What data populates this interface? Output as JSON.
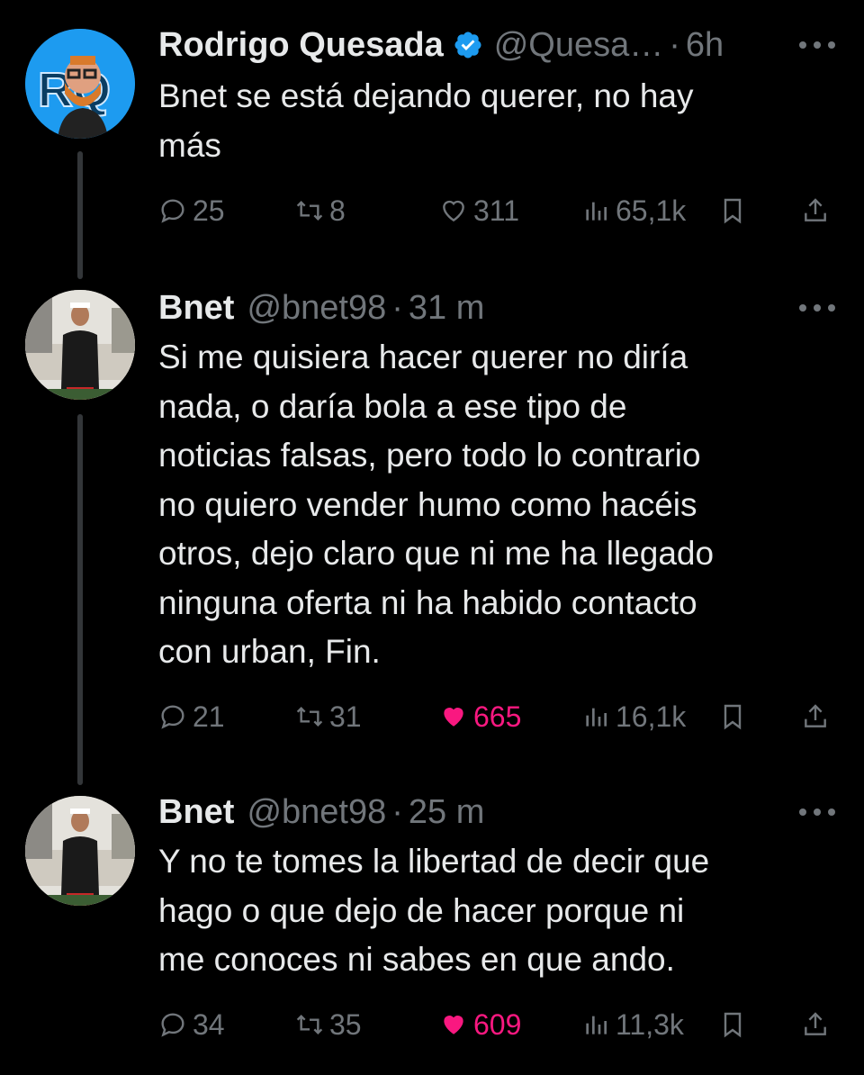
{
  "tweets": [
    {
      "author": "Rodrigo Quesada",
      "handle": "@Quesa…",
      "separator": "·",
      "time": "6h",
      "verified": true,
      "text": "Bnet se está dejando querer, no hay\nmás",
      "stats": {
        "replies": "25",
        "retweets": "8",
        "likes": "311",
        "views": "65,1k"
      },
      "liked": false,
      "avatar_color": "#1d9bf0"
    },
    {
      "author": "Bnet",
      "handle": "@bnet98",
      "separator": "·",
      "time": "31 m",
      "verified": false,
      "text": "Si me quisiera hacer querer no diría\nnada, o daría bola a ese tipo de\nnoticias falsas, pero todo lo contrario\nno quiero vender humo como hacéis\notros, dejo claro que ni me ha llegado\nninguna oferta ni ha habido contacto\ncon urban, Fin.",
      "stats": {
        "replies": "21",
        "retweets": "31",
        "likes": "665",
        "views": "16,1k"
      },
      "liked": true
    },
    {
      "author": "Bnet",
      "handle": "@bnet98",
      "separator": "·",
      "time": "25 m",
      "verified": false,
      "text": "Y no te tomes la libertad de decir que\nhago o que dejo de hacer porque ni\nme conoces ni sabes en que ando.",
      "stats": {
        "replies": "34",
        "retweets": "35",
        "likes": "609",
        "views": "11,3k"
      },
      "liked": true
    }
  ],
  "colors": {
    "like_active": "#f91880",
    "muted": "#71767b",
    "verified": "#1d9bf0",
    "thread_line": "#333639"
  },
  "icons": [
    "reply-icon",
    "retweet-icon",
    "heart-icon",
    "views-icon",
    "bookmark-icon",
    "share-icon",
    "more-icon",
    "verified-icon"
  ]
}
